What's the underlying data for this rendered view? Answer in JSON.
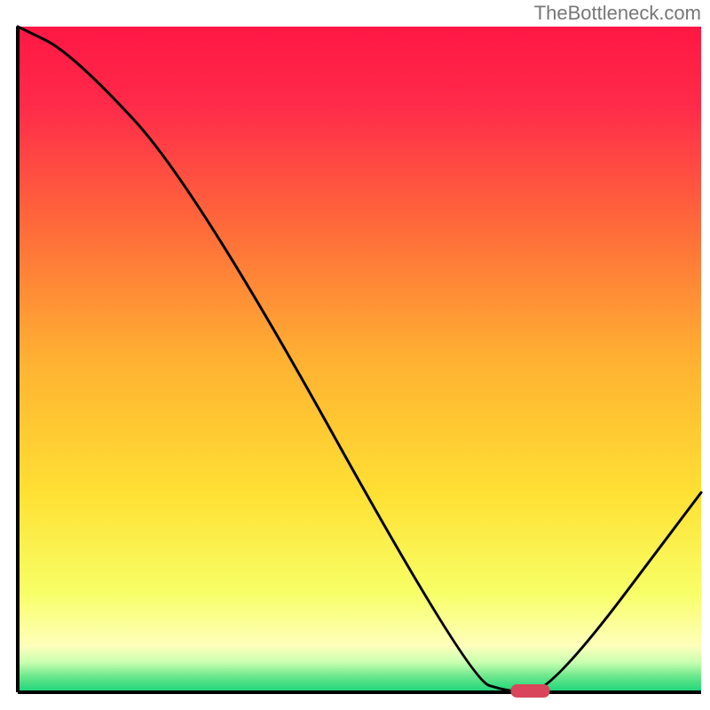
{
  "attribution": "TheBottleneck.com",
  "chart_data": {
    "type": "line",
    "title": "",
    "xlabel": "",
    "ylabel": "",
    "xlim": [
      0,
      100
    ],
    "ylim": [
      0,
      100
    ],
    "grid": false,
    "legend": false,
    "x": [
      0,
      8,
      26,
      66,
      72,
      78,
      100
    ],
    "values": [
      100,
      96,
      76,
      2,
      0,
      0,
      30
    ],
    "marker": {
      "x": 75,
      "y": 0
    },
    "gradient_stops": [
      {
        "offset": 0.0,
        "color": "#ff1744"
      },
      {
        "offset": 0.12,
        "color": "#ff2b4a"
      },
      {
        "offset": 0.3,
        "color": "#ff6a3a"
      },
      {
        "offset": 0.5,
        "color": "#ffb132"
      },
      {
        "offset": 0.7,
        "color": "#ffe033"
      },
      {
        "offset": 0.85,
        "color": "#f7ff66"
      },
      {
        "offset": 0.93,
        "color": "#ffffbb"
      },
      {
        "offset": 0.955,
        "color": "#c9ffb0"
      },
      {
        "offset": 0.975,
        "color": "#6fe88d"
      },
      {
        "offset": 1.0,
        "color": "#19d47a"
      }
    ]
  }
}
